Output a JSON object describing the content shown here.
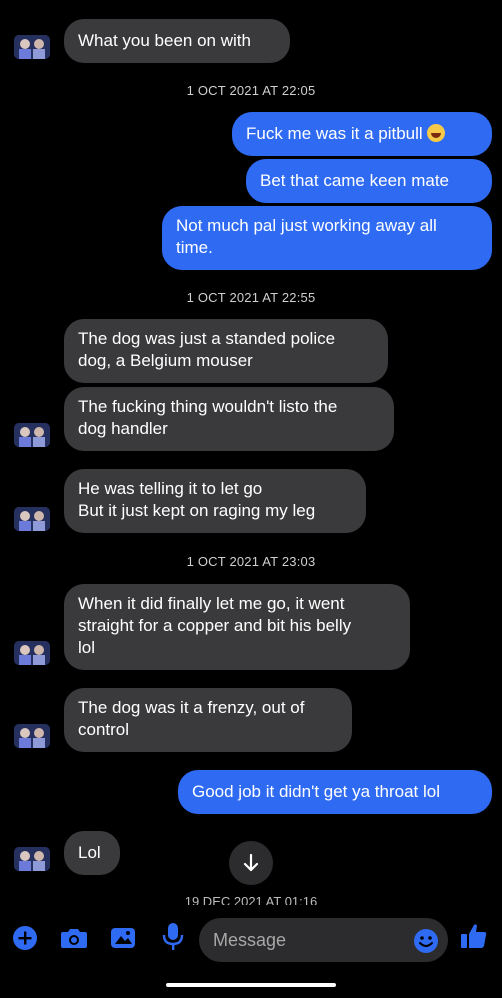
{
  "messages": [
    {
      "text": "What you been on with"
    },
    {
      "timestamp": "1 OCT 2021 AT 22:05"
    },
    {
      "text": "Fuck me was it a pitbull"
    },
    {
      "text": "Bet that came keen mate"
    },
    {
      "text_line1": "Not much pal just working away all",
      "text_line2": "time."
    },
    {
      "timestamp": "1 OCT 2021 AT 22:55"
    },
    {
      "text_line1": "The dog was just a standed police",
      "text_line2": "dog, a Belgium mouser"
    },
    {
      "text_line1": "The fucking thing wouldn't listo the",
      "text_line2": "dog handler"
    },
    {
      "text_line1": "He was telling it to let go",
      "text_line2": "But it just kept on raging my leg"
    },
    {
      "timestamp": "1 OCT 2021 AT 23:03"
    },
    {
      "text_line1": "When it did finally let me go, it went",
      "text_line2": "straight for a copper and bit his belly",
      "text_line3": "lol"
    },
    {
      "text_line1": "The dog was it a frenzy, out of",
      "text_line2": "control"
    },
    {
      "text": "Good job it didn't get ya throat lol"
    },
    {
      "text": "Lol"
    },
    {
      "timestamp": "19 DEC 2021 AT 01:16"
    }
  ],
  "composer": {
    "placeholder": "Message",
    "icons": [
      "plus-icon",
      "camera-icon",
      "image-icon",
      "microphone-icon",
      "emoji-icon",
      "thumbs-up-icon"
    ]
  },
  "colors": {
    "background": "#000000",
    "incoming_bubble": "#3a3a3c",
    "outgoing_bubble": "#2f6bf2",
    "accent": "#2f6bf2"
  }
}
